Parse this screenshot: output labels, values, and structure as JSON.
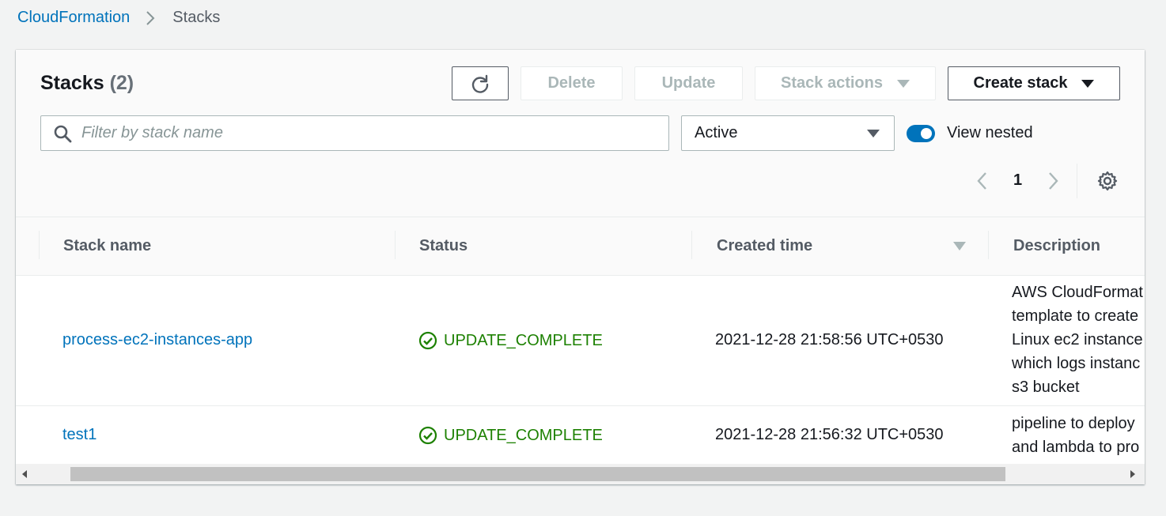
{
  "breadcrumb": {
    "root": "CloudFormation",
    "current": "Stacks"
  },
  "header": {
    "title": "Stacks",
    "count": "(2)"
  },
  "actions": {
    "refresh_icon": "refresh-icon",
    "delete": "Delete",
    "update": "Update",
    "stack_actions": "Stack actions",
    "create_stack": "Create stack"
  },
  "filter": {
    "placeholder": "Filter by stack name",
    "status_selected": "Active",
    "view_nested_label": "View nested",
    "view_nested_on": true
  },
  "pagination": {
    "current_page": "1"
  },
  "table": {
    "columns": [
      "Stack name",
      "Status",
      "Created time",
      "Description"
    ],
    "rows": [
      {
        "name": "process-ec2-instances-app",
        "status": "UPDATE_COMPLETE",
        "created": "2021-12-28 21:58:56 UTC+0530",
        "description": [
          "AWS CloudFormat",
          "template to create",
          "Linux ec2 instance",
          "which logs instanc",
          "s3 bucket"
        ]
      },
      {
        "name": "test1",
        "status": "UPDATE_COMPLETE",
        "created": "2021-12-28 21:56:32 UTC+0530",
        "description": [
          "pipeline to deploy",
          "and lambda to pro"
        ]
      }
    ]
  },
  "colors": {
    "link": "#0073bb",
    "success": "#1d8102",
    "toggle_on": "#0073bb"
  }
}
